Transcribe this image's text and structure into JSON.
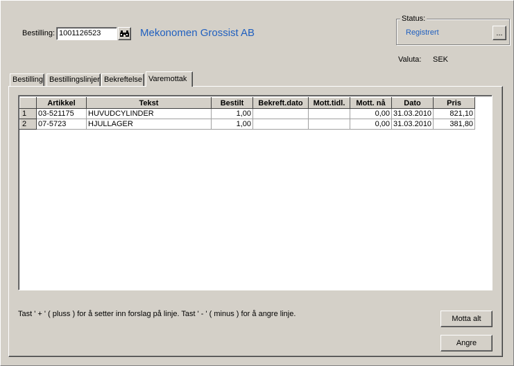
{
  "order": {
    "label": "Bestilling:",
    "number": "1001126523",
    "supplier": "Mekonomen Grossist AB"
  },
  "status": {
    "group_label": "Status:",
    "value": "Registrert",
    "more_button": "..."
  },
  "currency": {
    "label": "Valuta:",
    "value": "SEK"
  },
  "tabs": [
    {
      "label": "Bestilling"
    },
    {
      "label": "Bestillingslinjer"
    },
    {
      "label": "Bekreftelse"
    },
    {
      "label": "Varemottak"
    }
  ],
  "active_tab": "Varemottak",
  "grid": {
    "columns": [
      "",
      "Artikkel",
      "Tekst",
      "Bestilt",
      "Bekreft.dato",
      "Mott.tidl.",
      "Mott. nå",
      "Dato",
      "Pris"
    ],
    "rows": [
      {
        "nr": "1",
        "artikkel": "03-521175",
        "tekst": "HUVUDCYLINDER",
        "bestilt": "1,00",
        "bekreft_dato": "",
        "mott_tidl": "",
        "mott_na": "0,00",
        "dato": "31.03.2010",
        "pris": "821,10"
      },
      {
        "nr": "2",
        "artikkel": "07-5723",
        "tekst": "HJULLAGER",
        "bestilt": "1,00",
        "bekreft_dato": "",
        "mott_tidl": "",
        "mott_na": "0,00",
        "dato": "31.03.2010",
        "pris": "381,80"
      }
    ]
  },
  "hint": "Tast ' + ' ( pluss )  for å setter inn forslag på linje. Tast ' - ' ( minus ) for å angre linje.",
  "buttons": {
    "receive_all": "Motta alt",
    "undo": "Angre"
  },
  "icons": {
    "search": "binoculars-icon"
  },
  "colors": {
    "background": "#d4d0c8",
    "supplier_text": "#1f5fbf",
    "status_text": "#1f5fbf"
  }
}
